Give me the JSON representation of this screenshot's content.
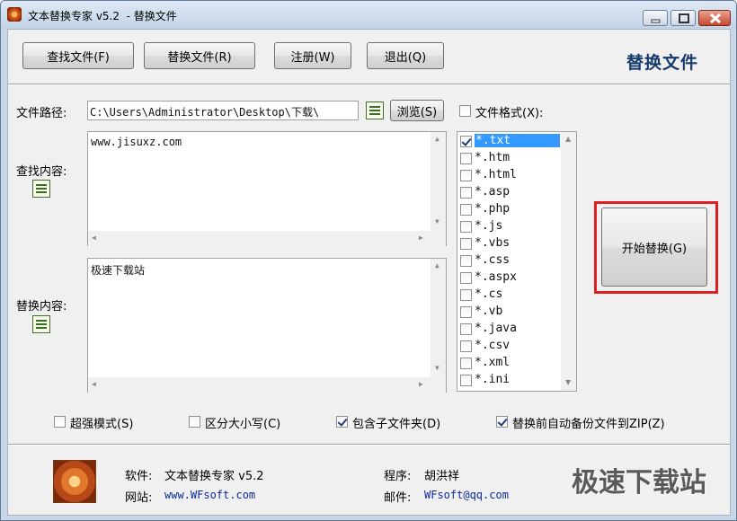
{
  "window": {
    "title": "文本替换专家 v5.2  - 替换文件",
    "min_label": "minimize",
    "max_label": "maximize",
    "close_label": "close"
  },
  "toolbar": {
    "find_files": "查找文件(F)",
    "replace_files": "替换文件(R)",
    "register": "注册(W)",
    "exit": "退出(Q)",
    "section_title": "替换文件"
  },
  "form": {
    "path_label": "文件路径:",
    "path_value": "C:\\Users\\Administrator\\Desktop\\下载\\",
    "browse": "浏览(S)",
    "file_format_label": "文件格式(X):",
    "find_label": "查找内容:",
    "find_value": "www.jisuxz.com",
    "replace_label": "替换内容:",
    "replace_value": "极速下载站"
  },
  "file_types": [
    {
      "label": "*.txt",
      "checked": true,
      "selected": true
    },
    {
      "label": "*.htm",
      "checked": false
    },
    {
      "label": "*.html",
      "checked": false
    },
    {
      "label": "*.asp",
      "checked": false
    },
    {
      "label": "*.php",
      "checked": false
    },
    {
      "label": "*.js",
      "checked": false
    },
    {
      "label": "*.vbs",
      "checked": false
    },
    {
      "label": "*.css",
      "checked": false
    },
    {
      "label": "*.aspx",
      "checked": false
    },
    {
      "label": "*.cs",
      "checked": false
    },
    {
      "label": "*.vb",
      "checked": false
    },
    {
      "label": "*.java",
      "checked": false
    },
    {
      "label": "*.csv",
      "checked": false
    },
    {
      "label": "*.xml",
      "checked": false
    },
    {
      "label": "*.ini",
      "checked": false
    }
  ],
  "actions": {
    "start_replace": "开始替换(G)"
  },
  "options": {
    "super_mode": {
      "label": "超强模式(S)",
      "checked": false
    },
    "match_case": {
      "label": "区分大小写(C)",
      "checked": false
    },
    "include_subfolders": {
      "label": "包含子文件夹(D)",
      "checked": true
    },
    "backup_zip": {
      "label": "替换前自动备份文件到ZIP(Z)",
      "checked": true
    }
  },
  "footer": {
    "software_label": "软件:",
    "software_value": "文本替换专家 v5.2",
    "site_label": "网站:",
    "site_value": "www.WFsoft.com",
    "author_label": "程序:",
    "author_value": "胡洪祥",
    "email_label": "邮件:",
    "email_value": "WFsoft@qq.com"
  },
  "watermark": "极速下载站",
  "colors": {
    "selection": "#3399ff",
    "highlight_frame": "#e02020",
    "link": "#0a2a9a"
  }
}
